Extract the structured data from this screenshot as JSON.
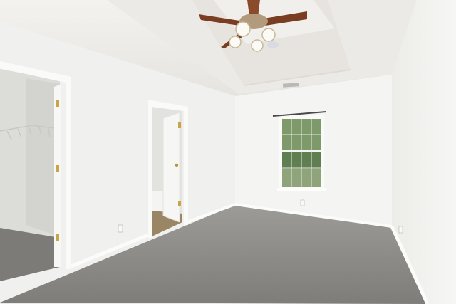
{
  "scene": {
    "kind": "photo",
    "colors": {
      "wall": "#f1f1ef",
      "wall_shadow": "#e4e4e1",
      "ceiling": "#ecebe8",
      "carpet": "#8e8c88",
      "trim": "#fbfbfa",
      "window_green": "#6f8f5c",
      "closet_interior": "#dcdcd8",
      "bath_floor": "#9a8565",
      "fan_wood": "#7a3d22"
    }
  },
  "objects": [
    {
      "name": "ceiling-fan",
      "icon": "ceiling-fan-icon"
    },
    {
      "name": "window",
      "icon": "window-icon"
    },
    {
      "name": "closet-door",
      "icon": "door-icon"
    },
    {
      "name": "bathroom-door",
      "icon": "door-icon"
    },
    {
      "name": "wire-shelf",
      "icon": "shelf-icon"
    },
    {
      "name": "curtain-rod",
      "icon": "rod-icon"
    },
    {
      "name": "air-vent",
      "icon": "vent-icon"
    }
  ]
}
